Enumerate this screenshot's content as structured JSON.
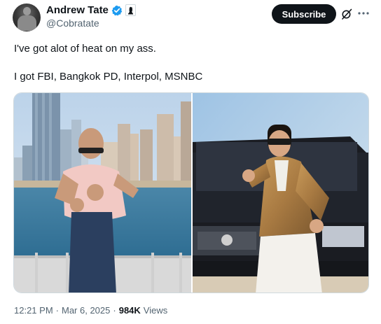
{
  "author": {
    "display_name": "Andrew Tate",
    "handle": "@Cobratate",
    "verified_icon": "verified-badge-icon",
    "affiliate_icon": "chess-piece-icon"
  },
  "actions": {
    "subscribe_label": "Subscribe",
    "grok_icon": "grok-icon",
    "more_icon": "more-icon"
  },
  "tweet": {
    "line1": "I've got alot of heat on my ass.",
    "line2": "I got FBI, Bangkok PD, Interpol, MSNBC"
  },
  "media": {
    "left_image": "man in pink t-shirt and sunglasses posing in front of marina skyscrapers",
    "right_image": "man in tan jacket and sunglasses posing in front of black SUV"
  },
  "meta": {
    "time": "12:21 PM",
    "sep1": "·",
    "date": "Mar 6, 2025",
    "sep2": "·",
    "views_count": "984K",
    "views_label": "Views"
  },
  "colors": {
    "accent": "#1d9bf0",
    "text": "#0f1419",
    "secondary": "#536471",
    "button_bg": "#0f1419"
  }
}
